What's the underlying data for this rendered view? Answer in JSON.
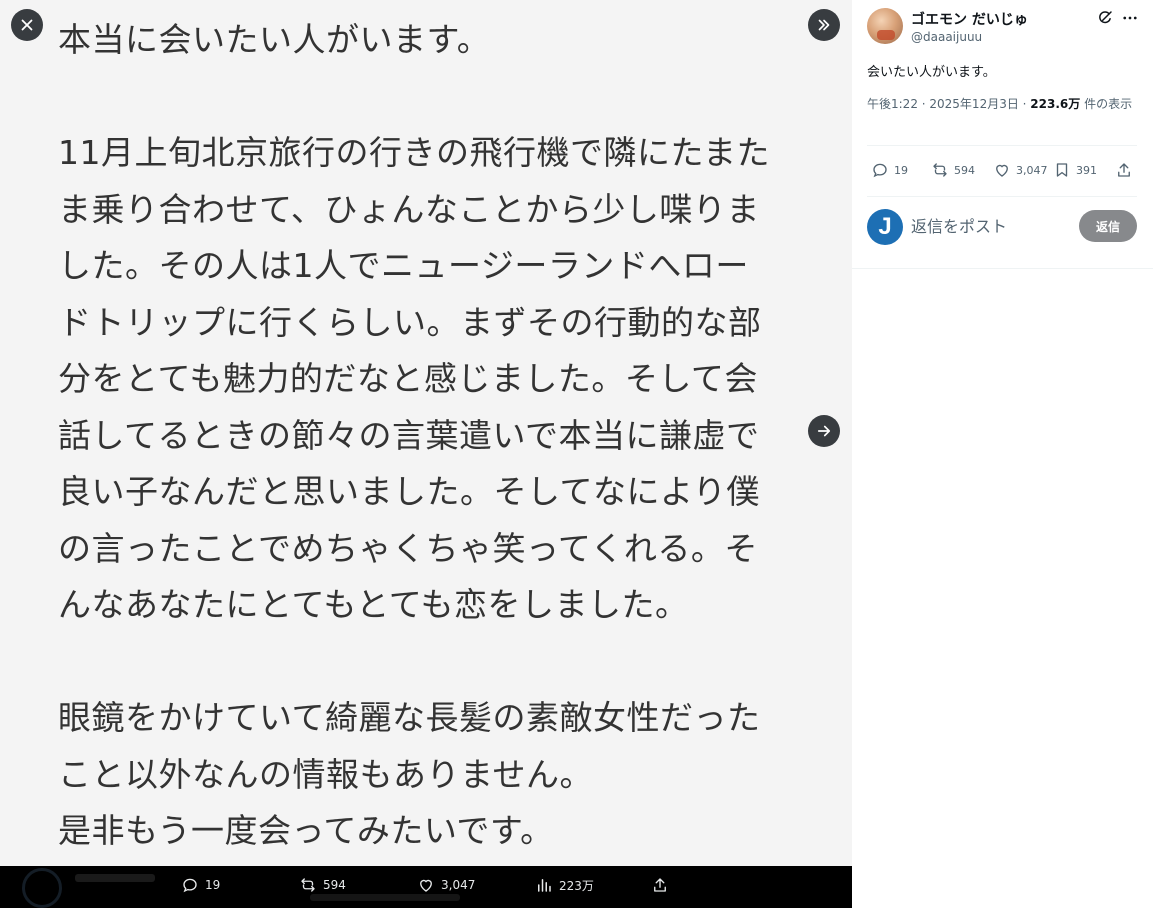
{
  "media": {
    "lines": [
      "本当に会いたい人がいます。",
      "",
      "11月上旬北京旅行の行きの飛行機で隣にたまた",
      "ま乗り合わせて、ひょんなことから少し喋りま",
      "した。その人は1人でニュージーランドへロー",
      "ドトリップに行くらしい。まずその行動的な部",
      "分をとても魅力的だなと感じました。そして会",
      "話してるときの節々の言葉遣いで本当に謙虚で",
      "良い子なんだと思いました。そしてなにより僕",
      "の言ったことでめちゃくちゃ笑ってくれる。そ",
      "んなあなたにとてもとても恋をしました。",
      "",
      "眼鏡をかけていて綺麗な長髪の素敵女性だった",
      "こと以外なんの情報もありません。",
      "是非もう一度会ってみたいです。"
    ]
  },
  "bottom_bar": {
    "replies": "19",
    "reposts": "594",
    "likes": "3,047",
    "views": "223万"
  },
  "post": {
    "display_name": "ゴエモン だいじゅ",
    "handle": "@daaaijuuu",
    "text": "会いたい人がいます。",
    "time_date": "午後1:22 · 2025年12月3日 · ",
    "views_count": "223.6万",
    "views_suffix": " 件の表示",
    "replies": "19",
    "reposts": "594",
    "likes": "3,047",
    "bookmarks": "391"
  },
  "reply_box": {
    "avatar_letter": "J",
    "placeholder": "返信をポスト",
    "button_label": "返信"
  }
}
